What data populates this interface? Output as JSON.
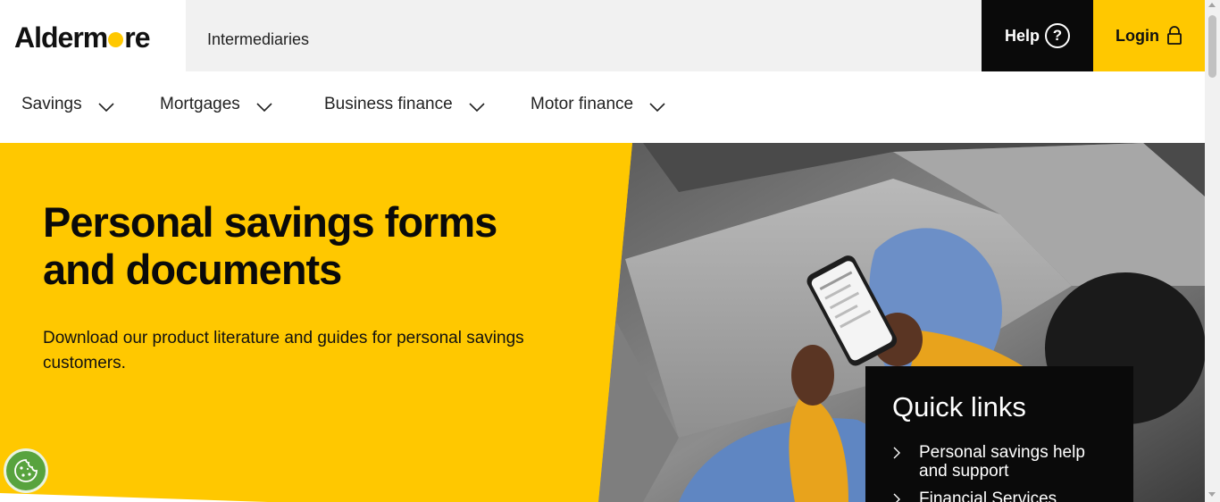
{
  "header": {
    "logo_text_start": "Alderm",
    "logo_text_end": "re",
    "intermediaries_label": "Intermediaries",
    "help_label": "Help",
    "help_icon_glyph": "?",
    "login_label": "Login",
    "brand_yellow": "#ffc800",
    "brand_black": "#0a0a0a"
  },
  "nav": {
    "items": [
      {
        "label": "Savings"
      },
      {
        "label": "Mortgages"
      },
      {
        "label": "Business finance"
      },
      {
        "label": "Motor finance"
      }
    ]
  },
  "hero": {
    "title": "Personal savings forms and documents",
    "subtitle": "Download our product literature and guides for personal savings customers.",
    "photo_description_icon": "person-sofa-phone-photo"
  },
  "quick_links": {
    "title": "Quick links",
    "items": [
      {
        "label": "Personal savings help and support"
      },
      {
        "label": "Financial Services"
      }
    ]
  },
  "cookie": {
    "icon": "cookie-icon"
  }
}
